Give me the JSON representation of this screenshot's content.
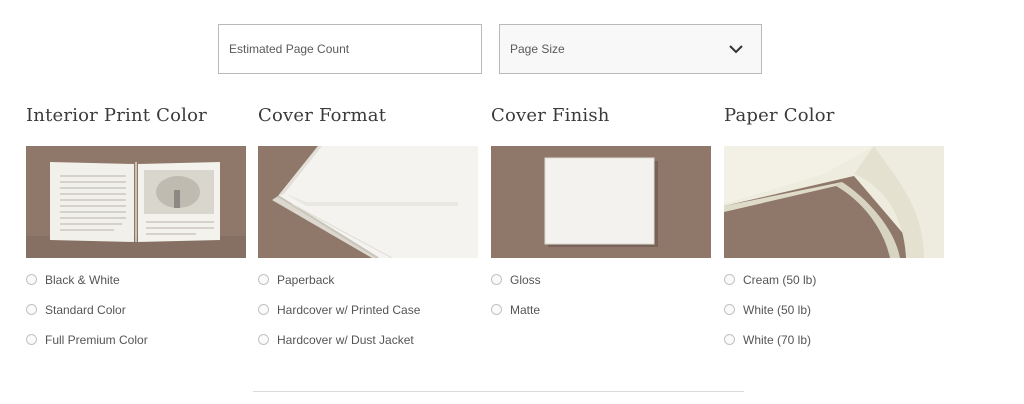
{
  "fields": {
    "page_count_placeholder": "Estimated Page Count",
    "page_size_label": "Page Size",
    "page_size_icon": "chevron-down-icon"
  },
  "columns": [
    {
      "title": "Interior Print Color",
      "image": "open-book-image",
      "options": [
        "Black & White",
        "Standard Color",
        "Full Premium Color"
      ]
    },
    {
      "title": "Cover Format",
      "image": "hardcover-spine-image",
      "options": [
        "Paperback",
        "Hardcover w/ Printed Case",
        "Hardcover w/ Dust Jacket"
      ]
    },
    {
      "title": "Cover Finish",
      "image": "cover-finish-image",
      "options": [
        "Gloss",
        "Matte"
      ]
    },
    {
      "title": "Paper Color",
      "image": "paper-stack-image",
      "options": [
        "Cream (50 lb)",
        "White (50 lb)",
        "White (70 lb)"
      ]
    }
  ],
  "colors": {
    "thumb_background": "#8c7467",
    "border": "#b9b9b9",
    "divider": "#dcdcdc"
  }
}
